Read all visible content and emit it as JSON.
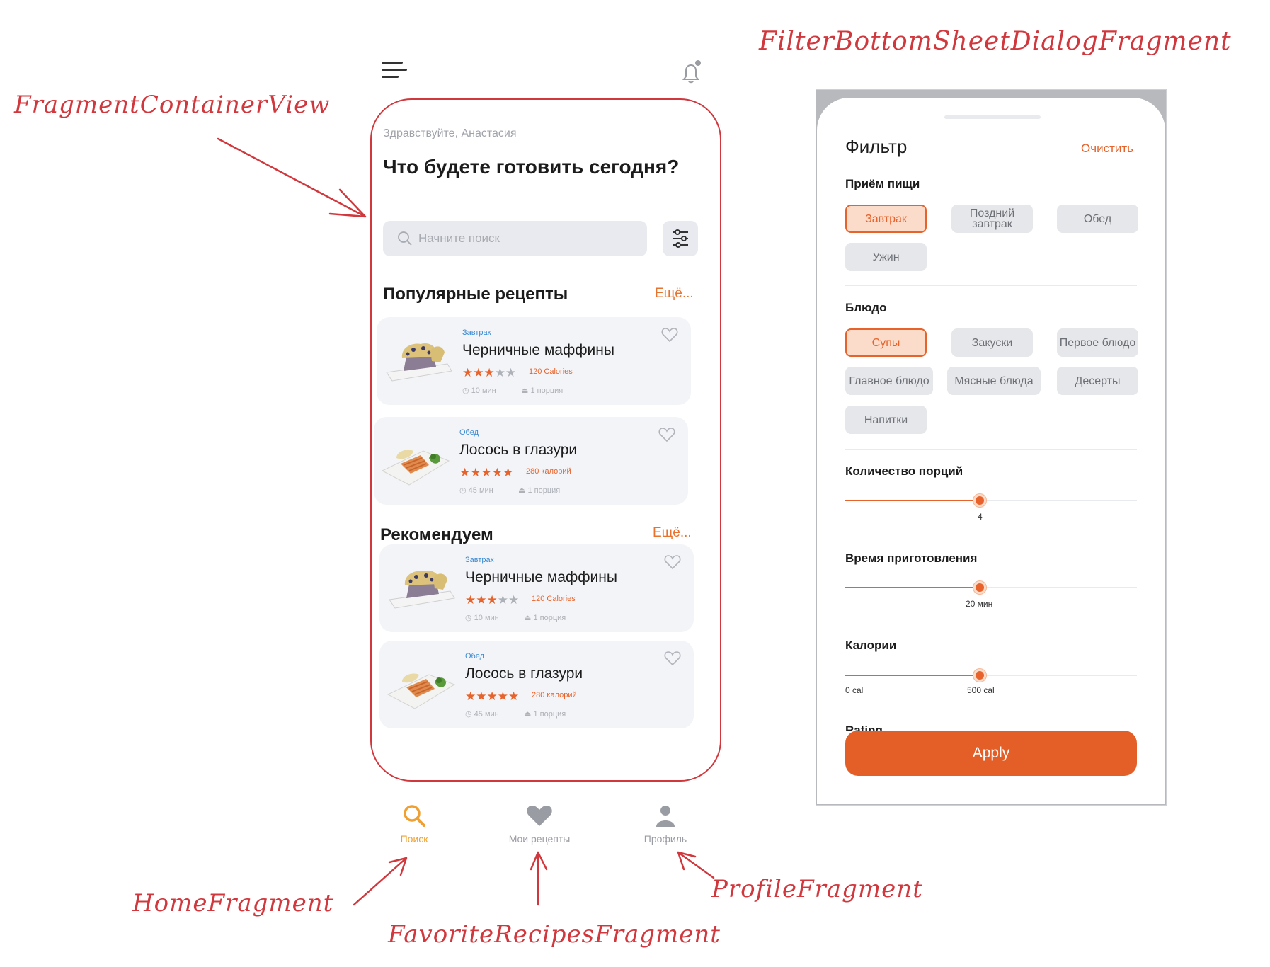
{
  "annotations": {
    "container": "FragmentContainerView",
    "filter_sheet": "FilterBottomSheetDialogFragment",
    "home": "HomeFragment",
    "favorites": "FavoriteRecipesFragment",
    "profile": "ProfileFragment"
  },
  "home": {
    "greeting": "Здравствуйте, Анастасия",
    "headline": "Что будете готовить сегодня?",
    "search_placeholder": "Начните поиск",
    "popular_title": "Популярные рецепты",
    "popular_more": "Ещё...",
    "recommended_title": "Рекомендуем",
    "recommended_more": "Ещё...",
    "popular": [
      {
        "category": "Завтрак",
        "title": "Черничные маффины",
        "rating": 3,
        "calories": "120 Calories",
        "time": "10 мин",
        "portions": "1 порция",
        "thumb": "muffin"
      },
      {
        "category": "Обед",
        "title": "Лосось в глазури",
        "rating": 5,
        "calories": "280 калорий",
        "time": "45 мин",
        "portions": "1 порция",
        "thumb": "salmon"
      }
    ],
    "recommended": [
      {
        "category": "Завтрак",
        "title": "Черничные маффины",
        "rating": 3,
        "calories": "120 Calories",
        "time": "10 мин",
        "portions": "1 порция",
        "thumb": "muffin"
      },
      {
        "category": "Обед",
        "title": "Лосось в глазури",
        "rating": 5,
        "calories": "280 калорий",
        "time": "45 мин",
        "portions": "1 порция",
        "thumb": "salmon"
      }
    ]
  },
  "nav": {
    "search": "Поиск",
    "favorites": "Мои рецепты",
    "profile": "Профиль",
    "active": "search",
    "active_color": "#f0a030",
    "inactive_color": "#9a9ca3"
  },
  "filter": {
    "title": "Фильтр",
    "clear": "Очистить",
    "meal_title": "Приём пищи",
    "meal_options": [
      "Завтрак",
      "Поздний завтрак",
      "Обед",
      "Ужин"
    ],
    "meal_selected": "Завтрак",
    "dish_title": "Блюдо",
    "dish_options": [
      "Супы",
      "Закуски",
      "Первое блюдо",
      "Главное блюдо",
      "Мясные блюда",
      "Десерты",
      "Напитки"
    ],
    "dish_selected": "Супы",
    "portions_title": "Количество порций",
    "portions_value": "4",
    "time_title": "Время приготовления",
    "time_value": "20 мин",
    "calories_title": "Калории",
    "calories_min": "0 cal",
    "calories_value": "500 cal",
    "rating_title": "Rating",
    "apply": "Apply",
    "accent": "#e8632b"
  }
}
